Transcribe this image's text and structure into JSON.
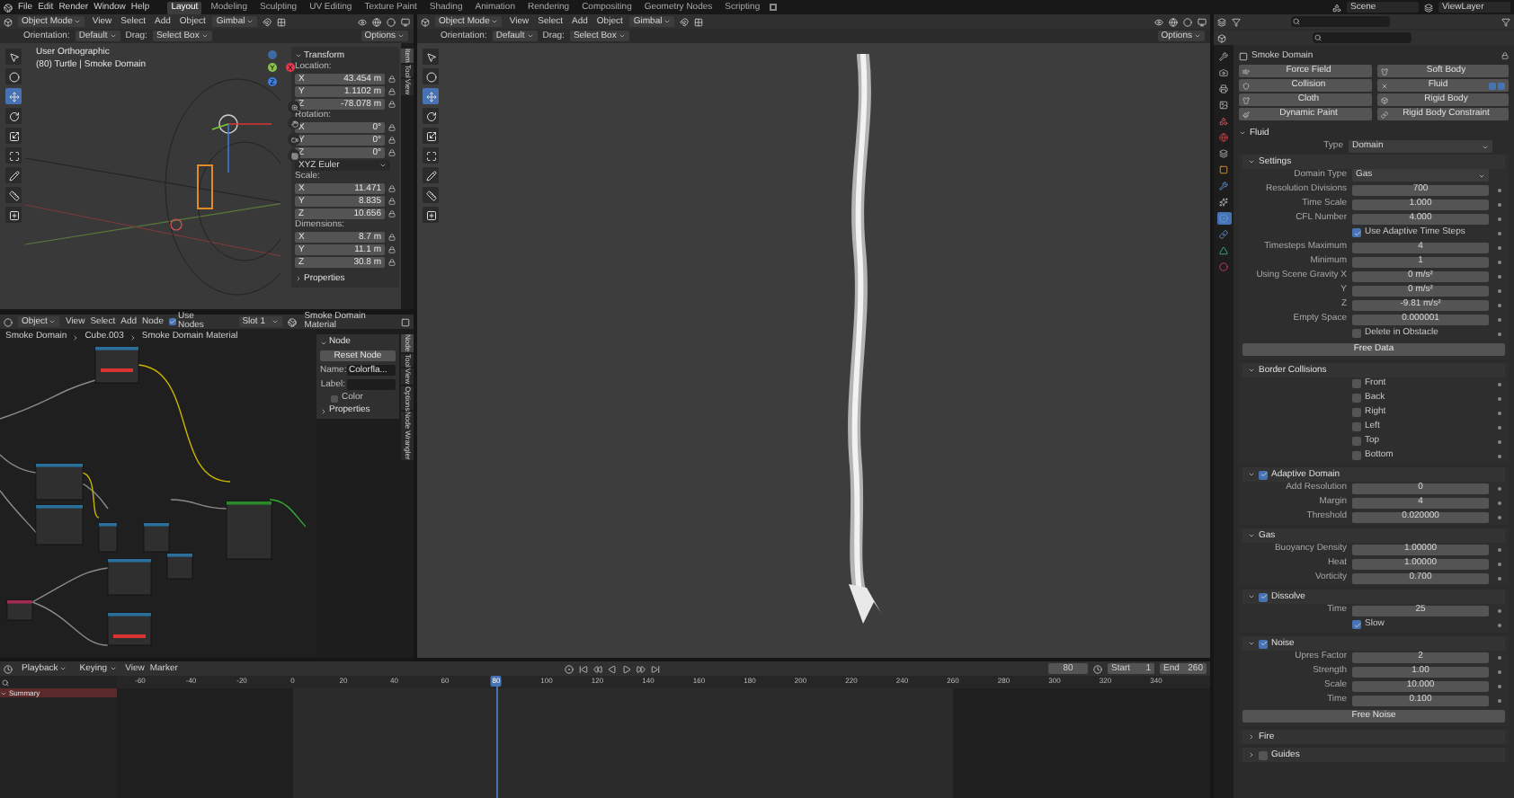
{
  "top_bar": {
    "menus": [
      "File",
      "Edit",
      "Render",
      "Window",
      "Help"
    ],
    "workspaces": [
      {
        "label": "Layout",
        "selected": true
      },
      {
        "label": "Modeling",
        "selected": false
      },
      {
        "label": "Sculpting",
        "selected": false
      },
      {
        "label": "UV Editing",
        "selected": false
      },
      {
        "label": "Texture Paint",
        "selected": false
      },
      {
        "label": "Shading",
        "selected": false
      },
      {
        "label": "Animation",
        "selected": false
      },
      {
        "label": "Rendering",
        "selected": false
      },
      {
        "label": "Compositing",
        "selected": false
      },
      {
        "label": "Geometry Nodes",
        "selected": false
      },
      {
        "label": "Scripting",
        "selected": false
      }
    ],
    "scene": "Scene",
    "view_layer": "ViewLayer"
  },
  "viewport_left": {
    "mode": "Object Mode",
    "menus": [
      "View",
      "Select",
      "Add",
      "Object"
    ],
    "orientation": "Gimbal",
    "tool_settings": {
      "orientation_label": "Orientation:",
      "orientation": "Default",
      "drag_label": "Drag:",
      "drag": "Select Box",
      "options": "Options"
    },
    "tools": [
      {
        "selected": false
      },
      {
        "selected": false
      },
      {
        "selected": true
      },
      {
        "selected": false
      },
      {
        "selected": false
      },
      {
        "selected": false
      },
      {
        "selected": false
      },
      {
        "selected": false
      },
      {
        "selected": false
      }
    ],
    "view_info": [
      "User Orthographic",
      "(80) Turtle | Smoke Domain"
    ],
    "axis_labels": [
      "Y",
      "X",
      "Z"
    ],
    "sidebar_tabs": [
      {
        "label": "Item",
        "selected": true
      },
      {
        "label": "Tool",
        "selected": false
      },
      {
        "label": "View",
        "selected": false
      }
    ],
    "transform": {
      "title": "Transform",
      "groups": [
        {
          "label": "Location:",
          "rows": [
            {
              "axis": "X",
              "value": "43.454 m"
            },
            {
              "axis": "Y",
              "value": "1.1102 m"
            },
            {
              "axis": "Z",
              "value": "-78.078 m"
            }
          ]
        },
        {
          "label": "Rotation:",
          "rows": [
            {
              "axis": "X",
              "value": "0°"
            },
            {
              "axis": "Y",
              "value": "0°"
            },
            {
              "axis": "Z",
              "value": "0°"
            }
          ],
          "mode": "XYZ Euler"
        },
        {
          "label": "Scale:",
          "rows": [
            {
              "axis": "X",
              "value": "11.471"
            },
            {
              "axis": "Y",
              "value": "8.835"
            },
            {
              "axis": "Z",
              "value": "10.656"
            }
          ]
        },
        {
          "label": "Dimensions:",
          "rows": [
            {
              "axis": "X",
              "value": "8.7 m"
            },
            {
              "axis": "Y",
              "value": "11.1 m"
            },
            {
              "axis": "Z",
              "value": "30.8 m"
            }
          ]
        }
      ],
      "properties": {
        "title": "Properties",
        "expanded": false
      }
    }
  },
  "viewport_main": {
    "mode": "Object Mode",
    "menus": [
      "View",
      "Select",
      "Add",
      "Object"
    ],
    "orientation": "Gimbal",
    "tool_settings": {
      "orientation_label": "Orientation:",
      "orientation": "Default",
      "drag_label": "Drag:",
      "drag": "Select Box",
      "options": "Options"
    },
    "tools": [
      {
        "selected": false
      },
      {
        "selected": false
      },
      {
        "selected": true
      },
      {
        "selected": false
      },
      {
        "selected": false
      },
      {
        "selected": false
      },
      {
        "selected": false
      },
      {
        "selected": false
      },
      {
        "selected": false
      }
    ]
  },
  "node_editor": {
    "type": "Object",
    "menus": [
      "View",
      "Select",
      "Add",
      "Node"
    ],
    "use_nodes": {
      "label": "Use Nodes",
      "checked": true
    },
    "slot": "Slot 1",
    "material": "Smoke Domain Material",
    "breadcrumbs": [
      "Smoke Domain",
      "Cube.003",
      "Smoke Domain Material"
    ],
    "sidebar": {
      "panel": "Node",
      "reset": "Reset Node",
      "name_label": "Name:",
      "name": "Colorfla...",
      "label_label": "Label:",
      "color": {
        "label": "Color",
        "checked": false
      },
      "properties": "Properties"
    },
    "sidebar_tabs": [
      {
        "label": "Node",
        "selected": true
      },
      {
        "label": "Tool",
        "selected": false
      },
      {
        "label": "View",
        "selected": false
      },
      {
        "label": "Options",
        "selected": false
      },
      {
        "label": "Node Wrangler",
        "selected": false
      }
    ]
  },
  "timeline": {
    "menus": [
      {
        "label": "Playback",
        "dropdown": true
      },
      {
        "label": "Keying",
        "dropdown": true
      },
      {
        "label": "View",
        "dropdown": false
      },
      {
        "label": "Marker",
        "dropdown": false
      }
    ],
    "current_frame": "80",
    "start_label": "Start",
    "start": "1",
    "end_label": "End",
    "end": "260",
    "ticks": [
      "-60",
      "-40",
      "-20",
      "0",
      "20",
      "40",
      "60",
      "100",
      "120",
      "140",
      "160",
      "180",
      "200",
      "220",
      "240",
      "260",
      "280",
      "300",
      "320",
      "340"
    ],
    "playhead": {
      "label": "80",
      "level": 0.347
    },
    "channels": [
      "Summary"
    ]
  },
  "properties": {
    "tabs": [
      {
        "selected": false
      },
      {
        "selected": false
      },
      {
        "selected": false
      },
      {
        "selected": false
      },
      {
        "selected": false
      },
      {
        "selected": false
      },
      {
        "selected": false
      },
      {
        "selected": false
      },
      {
        "selected": false
      },
      {
        "selected": false
      },
      {
        "selected": true
      },
      {
        "selected": false
      },
      {
        "selected": false
      },
      {
        "selected": false
      }
    ],
    "object": "Smoke Domain",
    "physics_buttons": [
      {
        "label": "Force Field",
        "enabled": false
      },
      {
        "label": "Soft Body",
        "enabled": false
      },
      {
        "label": "Collision",
        "enabled": false
      },
      {
        "label": "Fluid",
        "enabled": true
      },
      {
        "label": "Cloth",
        "enabled": false
      },
      {
        "label": "Rigid Body",
        "enabled": false
      },
      {
        "label": "Dynamic Paint",
        "enabled": false
      },
      {
        "label": "Rigid Body Constraint",
        "enabled": false
      }
    ],
    "panels": [
      {
        "title": "Fluid",
        "expanded": true,
        "rows": [
          {
            "kind": "dropdown",
            "label": "Type",
            "value": "Domain"
          }
        ],
        "children": [
          {
            "title": "Settings",
            "expanded": true,
            "rows": [
              {
                "kind": "dropdown",
                "label": "Domain Type",
                "value": "Gas"
              },
              {
                "kind": "number",
                "label": "Resolution Divisions",
                "value": "700"
              },
              {
                "kind": "number",
                "label": "Time Scale",
                "value": "1.000"
              },
              {
                "kind": "number",
                "label": "CFL Number",
                "value": "4.000"
              },
              {
                "kind": "checkbox",
                "label": "Use Adaptive Time Steps",
                "checked": true
              },
              {
                "kind": "number",
                "label": "Timesteps Maximum",
                "value": "4"
              },
              {
                "kind": "number",
                "label": "Minimum",
                "value": "1"
              },
              {
                "kind": "number",
                "label": "Using Scene Gravity X",
                "value": "0 m/s²"
              },
              {
                "kind": "number",
                "label": "Y",
                "value": "0 m/s²"
              },
              {
                "kind": "number",
                "label": "Z",
                "value": "-9.81 m/s²"
              },
              {
                "kind": "number",
                "label": "Empty Space",
                "value": "0.000001"
              },
              {
                "kind": "checkbox",
                "label": "Delete in Obstacle",
                "checked": false
              },
              {
                "kind": "button",
                "label": "Free Data"
              }
            ]
          },
          {
            "title": "Border Collisions",
            "expanded": true,
            "rows": [
              {
                "kind": "checkbox",
                "label": "Front",
                "checked": false
              },
              {
                "kind": "checkbox",
                "label": "Back",
                "checked": false
              },
              {
                "kind": "checkbox",
                "label": "Right",
                "checked": false
              },
              {
                "kind": "checkbox",
                "label": "Left",
                "checked": false
              },
              {
                "kind": "checkbox",
                "label": "Top",
                "checked": false
              },
              {
                "kind": "checkbox",
                "label": "Bottom",
                "checked": false
              }
            ]
          },
          {
            "title": "Adaptive Domain",
            "expanded": true,
            "checked": true,
            "rows": [
              {
                "kind": "number",
                "label": "Add Resolution",
                "value": "0"
              },
              {
                "kind": "number",
                "label": "Margin",
                "value": "4"
              },
              {
                "kind": "number",
                "label": "Threshold",
                "value": "0.020000"
              }
            ]
          },
          {
            "title": "Gas",
            "expanded": true,
            "rows": [
              {
                "kind": "number",
                "label": "Buoyancy Density",
                "value": "1.00000"
              },
              {
                "kind": "number",
                "label": "Heat",
                "value": "1.00000"
              },
              {
                "kind": "number",
                "label": "Vorticity",
                "value": "0.700"
              }
            ]
          },
          {
            "title": "Dissolve",
            "expanded": true,
            "checked": true,
            "rows": [
              {
                "kind": "number",
                "label": "Time",
                "value": "25"
              },
              {
                "kind": "checkbox",
                "label": "Slow",
                "checked": true
              }
            ]
          },
          {
            "title": "Noise",
            "expanded": true,
            "checked": true,
            "rows": [
              {
                "kind": "number",
                "label": "Upres Factor",
                "value": "2"
              },
              {
                "kind": "number",
                "label": "Strength",
                "value": "1.00"
              },
              {
                "kind": "number",
                "label": "Scale",
                "value": "10.000"
              },
              {
                "kind": "number",
                "label": "Time",
                "value": "0.100"
              },
              {
                "kind": "button",
                "label": "Free Noise"
              }
            ]
          },
          {
            "title": "Fire",
            "expanded": false
          },
          {
            "title": "Guides",
            "expanded": false,
            "checked": false
          }
        ]
      }
    ]
  }
}
